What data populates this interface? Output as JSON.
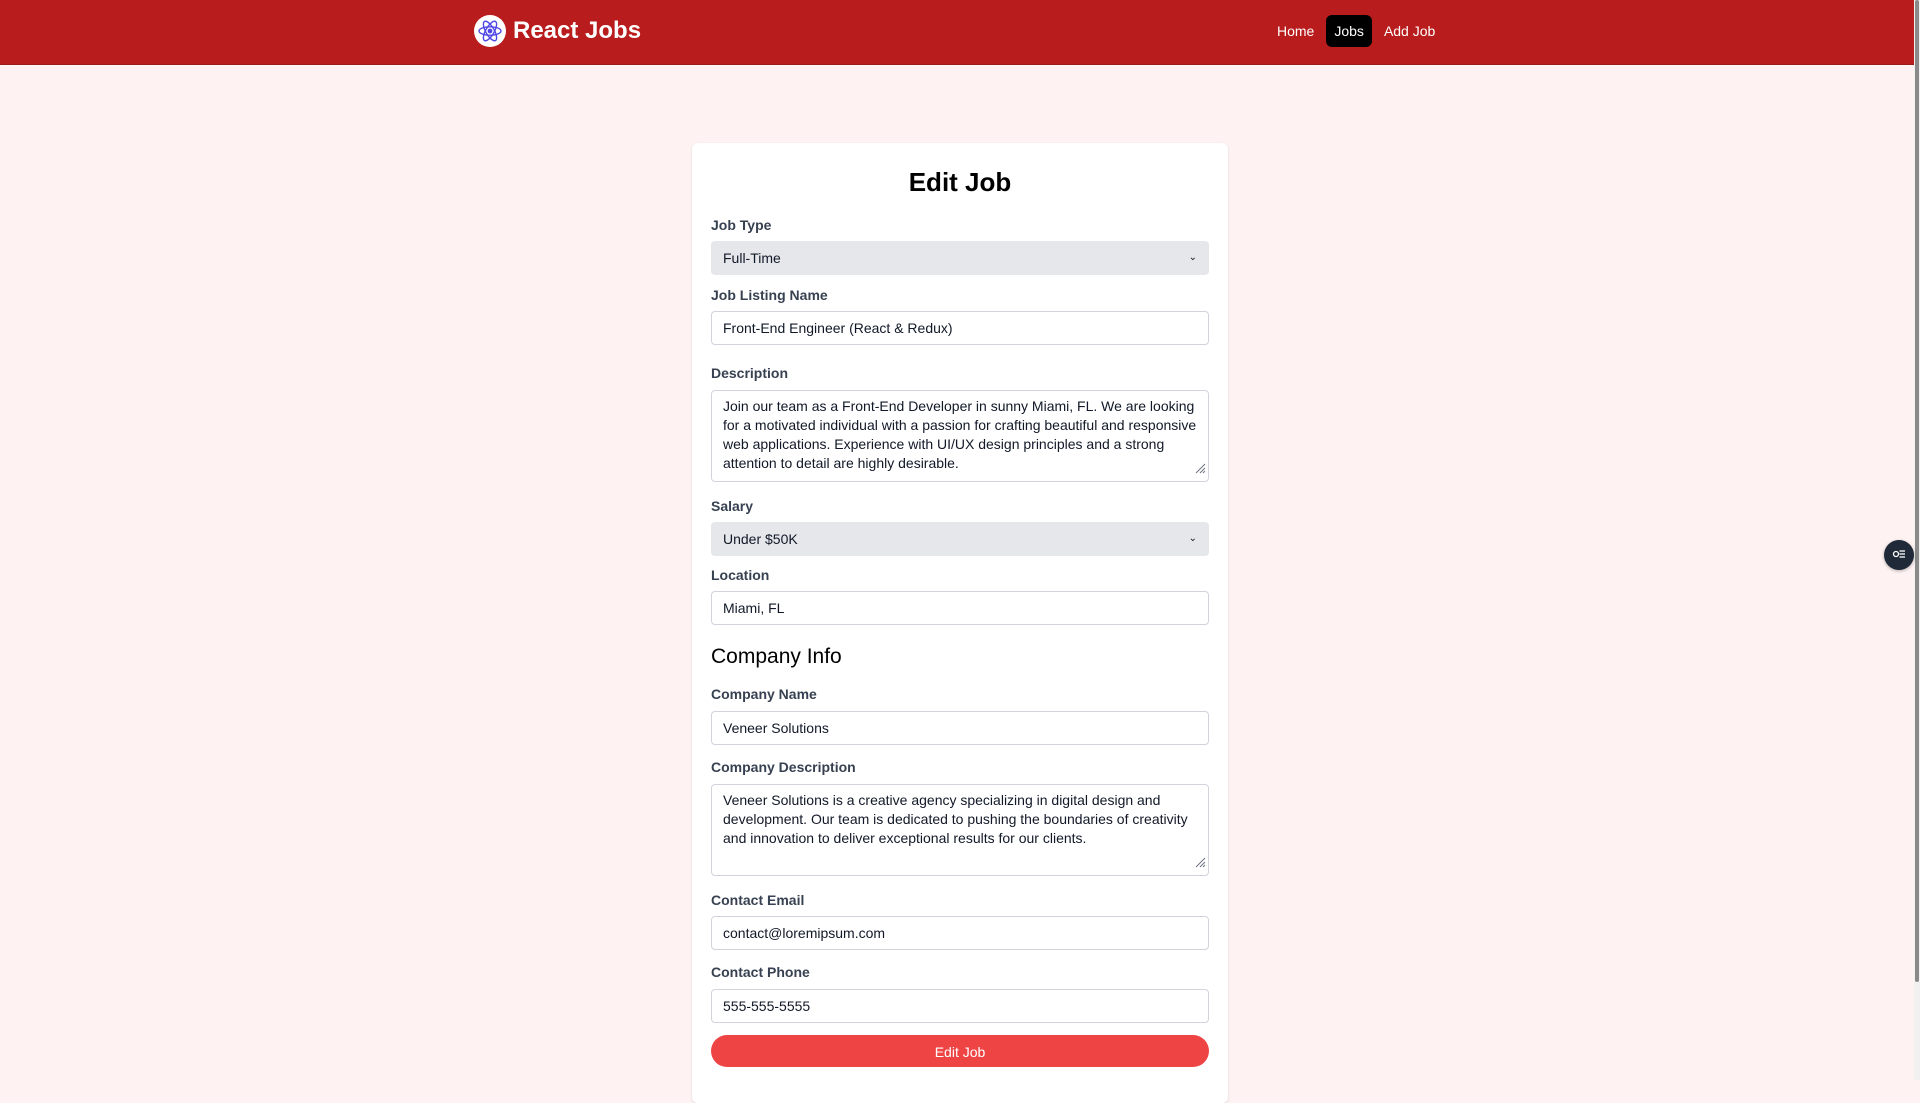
{
  "navbar": {
    "brand": "React Jobs",
    "links": [
      {
        "label": "Home",
        "active": false
      },
      {
        "label": "Jobs",
        "active": true
      },
      {
        "label": "Add Job",
        "active": false
      }
    ]
  },
  "form": {
    "title": "Edit Job",
    "job_type": {
      "label": "Job Type",
      "value": "Full-Time"
    },
    "job_name": {
      "label": "Job Listing Name",
      "value": "Front-End Engineer (React & Redux)"
    },
    "description": {
      "label": "Description",
      "value": "Join our team as a Front-End Developer in sunny Miami, FL. We are looking for a motivated individual with a passion for crafting beautiful and responsive web applications. Experience with UI/UX design principles and a strong attention to detail are highly desirable."
    },
    "salary": {
      "label": "Salary",
      "value": "Under $50K"
    },
    "location": {
      "label": "Location",
      "value": "Miami, FL"
    },
    "company_heading": "Company Info",
    "company_name": {
      "label": "Company Name",
      "value": "Veneer Solutions"
    },
    "company_description": {
      "label": "Company Description",
      "value": "Veneer Solutions is a creative agency specializing in digital design and development. Our team is dedicated to pushing the boundaries of creativity and innovation to deliver exceptional results for our clients."
    },
    "contact_email": {
      "label": "Contact Email",
      "value": "contact@loremipsum.com"
    },
    "contact_phone": {
      "label": "Contact Phone",
      "value": "555-555-5555"
    },
    "submit_label": "Edit Job"
  },
  "colors": {
    "navbar": "#b91c1c",
    "page_bg": "#fef2f2",
    "active_link": "#000000",
    "submit_button": "#ef4444"
  },
  "icons": [
    "react-logo-icon",
    "chevron-down-icon",
    "resize-grip-icon",
    "floating-tools-icon"
  ]
}
